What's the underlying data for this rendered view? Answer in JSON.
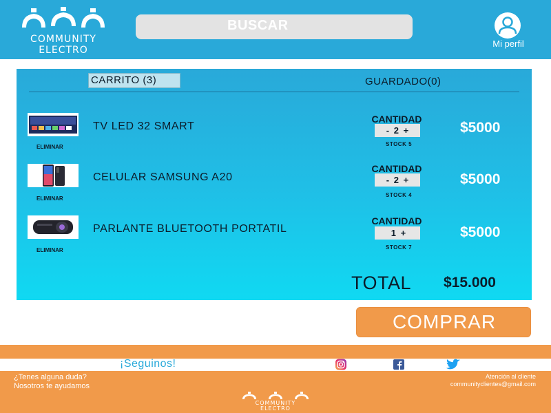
{
  "header": {
    "logo_line1": "COMMUNITY",
    "logo_line2": "ELECTRO",
    "search_label": "BUSCAR",
    "profile_label": "Mi perfil"
  },
  "cart": {
    "tab_cart": "CARRITO (3)",
    "tab_saved": "GUARDADO(0)",
    "items": [
      {
        "name": "TV LED 32 SMART",
        "remove_label": "ELIMINAR",
        "qty_label": "CANTIDAD",
        "minus": "-",
        "qty": "2",
        "plus": "+",
        "stock": "STOCK 5",
        "price": "$5000"
      },
      {
        "name": "CELULAR SAMSUNG A20",
        "remove_label": "ELIMINAR",
        "qty_label": "CANTIDAD",
        "minus": "-",
        "qty": "2",
        "plus": "+",
        "stock": "STOCK 4",
        "price": "$5000"
      },
      {
        "name": "PARLANTE BLUETOOTH PORTATIL",
        "remove_label": "ELIMINAR",
        "qty_label": "CANTIDAD",
        "minus": "",
        "qty": "1",
        "plus": "+",
        "stock": "STOCK 7",
        "price": "$5000"
      }
    ],
    "total_label": "TOTAL",
    "total_value": "$15.000",
    "buy_label": "COMPRAR"
  },
  "footer": {
    "follow_label": "¡Seguinos!",
    "help_line1": "¿Tenes alguna duda?",
    "help_line2": "Nosotros te ayudamos",
    "contact_line1": "Atención al cliente",
    "contact_line2": "communityclientes@gmail.com",
    "logo_line1": "COMMUNITY",
    "logo_line2": "ELECTRO",
    "social_icons": [
      "instagram-icon",
      "facebook-icon",
      "twitter-icon"
    ]
  },
  "colors": {
    "brand_blue": "#29a9d9",
    "brand_orange": "#f19a4a",
    "panel_bottom": "#10d9f2"
  }
}
